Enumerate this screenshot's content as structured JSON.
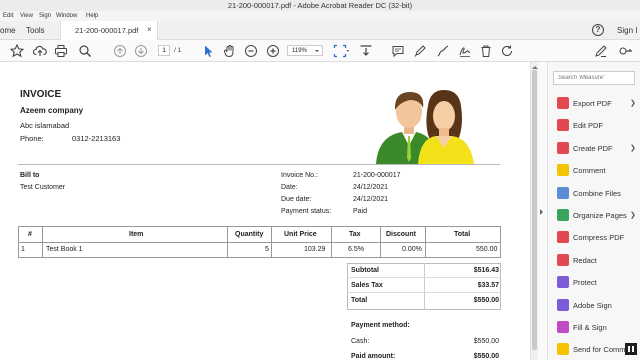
{
  "window": {
    "title": "21-200-000017.pdf - Adobe Acrobat Reader DC (32-bit)"
  },
  "menu": [
    "Edit",
    "View",
    "Sign",
    "Window",
    "Help"
  ],
  "tabs": {
    "home": "ome",
    "tools": "Tools",
    "doc": "21-200-000017.pdf",
    "close": "×"
  },
  "account": {
    "sign_in": "Sign I"
  },
  "toolbar": {
    "page": "1",
    "page_total": "/ 1",
    "zoom": "119%"
  },
  "invoice": {
    "title": "INVOICE",
    "company": "Azeem company",
    "city": "Abc islamabad",
    "phone_label": "Phone:",
    "phone": "0312-2213163",
    "bill_to_label": "Bill to",
    "bill_to": "Test Customer",
    "meta": [
      {
        "label": "Invoice No.:",
        "value": "21-200-000017"
      },
      {
        "label": "Date:",
        "value": "24/12/2021"
      },
      {
        "label": "Due date:",
        "value": "24/12/2021"
      },
      {
        "label": "Payment status:",
        "value": "Paid"
      }
    ],
    "table": {
      "headers": [
        "#",
        "Item",
        "Quantity",
        "Unit Price",
        "Tax",
        "Discount",
        "Total"
      ],
      "rows": [
        [
          "1",
          "Test Book 1",
          "5",
          "103.29",
          "6.5%",
          "0.00%",
          "550.00"
        ]
      ]
    },
    "totals": [
      {
        "label": "Subtotal",
        "value": "$516.43"
      },
      {
        "label": "Sales Tax",
        "value": "$33.57"
      },
      {
        "label": "Total",
        "value": "$550.00"
      }
    ],
    "payment": {
      "title": "Payment method:",
      "rows": [
        {
          "label": "Cash:",
          "value": "$550.00"
        },
        {
          "label": "Paid amount:",
          "value": "$550.00"
        }
      ]
    }
  },
  "right_pane": {
    "search_placeholder": "Search 'Measure'",
    "tools": [
      {
        "label": "Export PDF",
        "icon": "export-pdf-icon",
        "color": "#e34850",
        "chevron": "❯"
      },
      {
        "label": "Edit PDF",
        "icon": "edit-pdf-icon",
        "color": "#e34850",
        "chevron": ""
      },
      {
        "label": "Create PDF",
        "icon": "create-pdf-icon",
        "color": "#e34850",
        "chevron": "❯"
      },
      {
        "label": "Comment",
        "icon": "comment-icon",
        "color": "#f5c400",
        "chevron": ""
      },
      {
        "label": "Combine Files",
        "icon": "combine-files-icon",
        "color": "#5a8dd6",
        "chevron": ""
      },
      {
        "label": "Organize Pages",
        "icon": "organize-pages-icon",
        "color": "#3aa55a",
        "chevron": "❯"
      },
      {
        "label": "Compress PDF",
        "icon": "compress-pdf-icon",
        "color": "#e34850",
        "chevron": ""
      },
      {
        "label": "Redact",
        "icon": "redact-icon",
        "color": "#e34850",
        "chevron": ""
      },
      {
        "label": "Protect",
        "icon": "protect-icon",
        "color": "#7b5bd6",
        "chevron": ""
      },
      {
        "label": "Adobe Sign",
        "icon": "adobe-sign-icon",
        "color": "#7b5bd6",
        "chevron": ""
      },
      {
        "label": "Fill & Sign",
        "icon": "fill-sign-icon",
        "color": "#c04bc4",
        "chevron": ""
      },
      {
        "label": "Send for Comm",
        "icon": "send-for-comment-icon",
        "color": "#f5c400",
        "chevron": ""
      }
    ]
  }
}
